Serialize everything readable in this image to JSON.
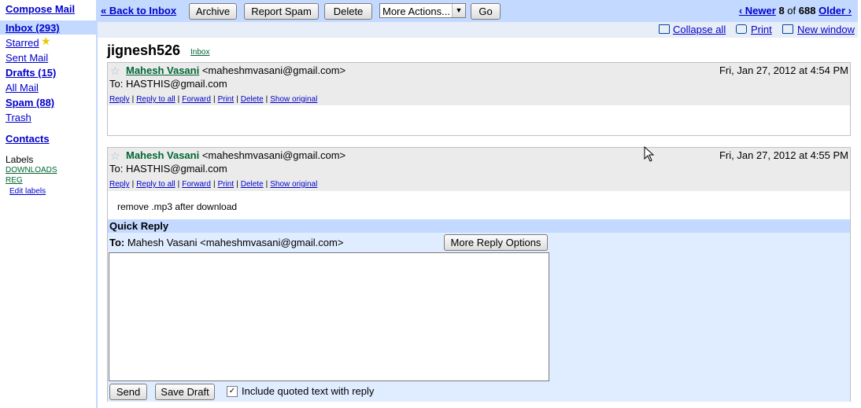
{
  "sidebar": {
    "compose": "Compose Mail",
    "inbox": "Inbox (293)",
    "starred": "Starred",
    "sent": "Sent Mail",
    "drafts": "Drafts (15)",
    "all_mail": "All Mail",
    "spam": "Spam (88)",
    "trash": "Trash",
    "contacts": "Contacts",
    "labels_title": "Labels",
    "labels": [
      "DOWNLOADS",
      "REG"
    ],
    "edit_labels": "Edit labels"
  },
  "toolbar": {
    "back": "« Back to Inbox",
    "archive": "Archive",
    "report_spam": "Report Spam",
    "delete": "Delete",
    "more_actions": "More Actions...",
    "go": "Go",
    "newer": "‹ Newer",
    "position": "8",
    "of_text": "of",
    "total": "688",
    "older": "Older ›"
  },
  "subbar": {
    "collapse": "Collapse all",
    "print": "Print",
    "new_window": "New window"
  },
  "conversation": {
    "subject": "jignesh526",
    "label": "Inbox"
  },
  "messages": [
    {
      "sender_name": "Mahesh Vasani",
      "sender_email": "<maheshmvasani@gmail.com>",
      "date": "Fri, Jan 27, 2012 at 4:54 PM",
      "to": "To: HASTHIS@gmail.com",
      "actions": [
        "Reply",
        "Reply to all",
        "Forward",
        "Print",
        "Delete",
        "Show original"
      ],
      "body": ""
    },
    {
      "sender_name": "Mahesh Vasani",
      "sender_email": "<maheshmvasani@gmail.com>",
      "date": "Fri, Jan 27, 2012 at 4:55 PM",
      "to": "To: HASTHIS@gmail.com",
      "actions": [
        "Reply",
        "Reply to all",
        "Forward",
        "Print",
        "Delete",
        "Show original"
      ],
      "body": "remove .mp3 after download"
    }
  ],
  "quick_reply": {
    "title": "Quick Reply",
    "to_label": "To:",
    "to_value": "Mahesh Vasani <maheshmvasani@gmail.com>",
    "more_options": "More Reply Options",
    "send": "Send",
    "save_draft": "Save Draft",
    "include_quoted": "Include quoted text with reply",
    "include_checked": true
  }
}
